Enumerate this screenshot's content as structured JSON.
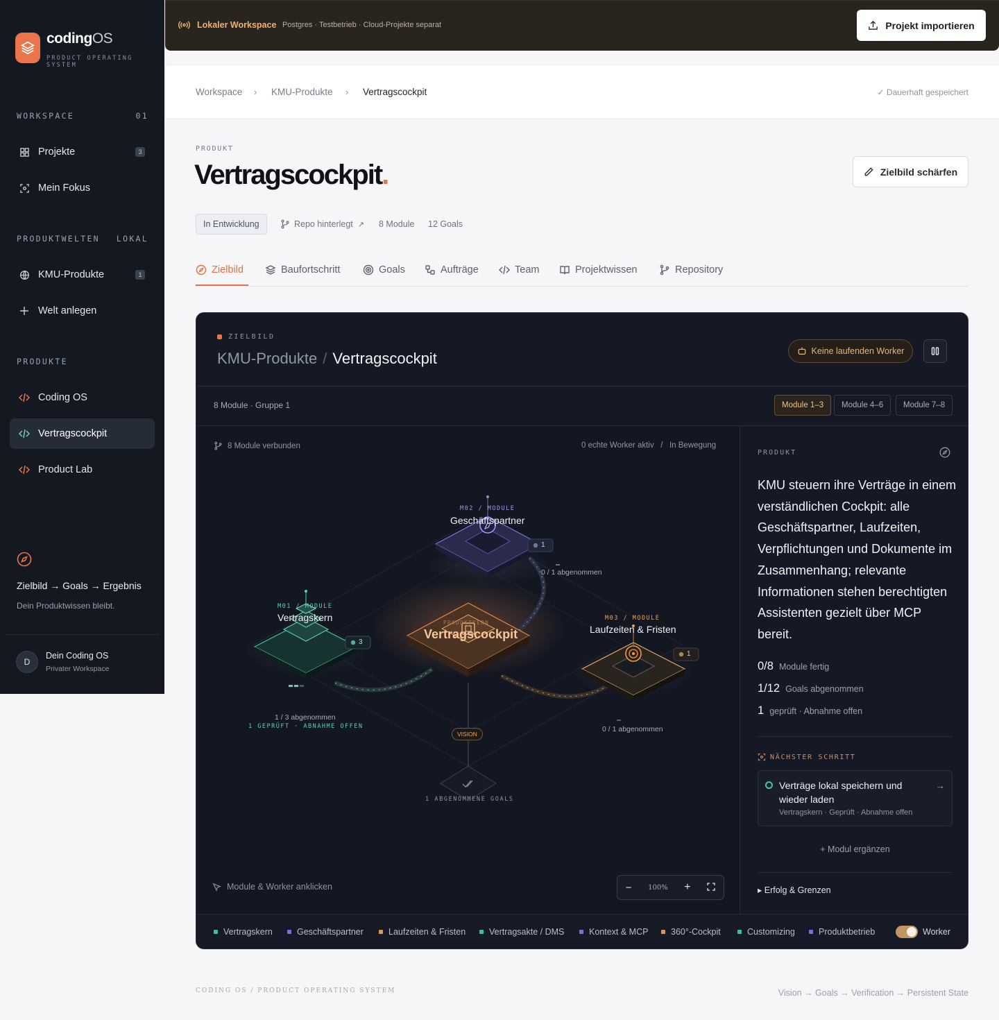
{
  "brand": {
    "name": "coding",
    "name_suffix": "OS",
    "subtitle": "PRODUCT OPERATING SYSTEM"
  },
  "sidebar": {
    "workspace_heading": "WORKSPACE",
    "workspace_number": "01",
    "workspace_items": [
      {
        "label": "Projekte",
        "count": "3",
        "icon": "grid-icon"
      },
      {
        "label": "Mein Fokus",
        "icon": "focus-icon"
      }
    ],
    "worlds_heading": "PRODUKTWELTEN",
    "worlds_tag": "LOKAL",
    "world_items": [
      {
        "label": "KMU-Produkte",
        "count": "1",
        "icon": "globe-icon"
      },
      {
        "label": "Welt anlegen",
        "icon": "plus-icon"
      }
    ],
    "products_heading": "PRODUKTE",
    "product_items": [
      {
        "label": "Coding OS",
        "icon": "code-icon"
      },
      {
        "label": "Vertragscockpit",
        "icon": "code-icon",
        "active": true
      },
      {
        "label": "Product Lab",
        "icon": "code-icon"
      }
    ],
    "flow": "Zielbild → Goals → Ergebnis",
    "flow_sub": "Dein Produktwissen bleibt.",
    "user": {
      "initial": "D",
      "name": "Dein Coding OS",
      "sub": "Privater Workspace"
    }
  },
  "banner": {
    "title": "Lokaler Workspace",
    "subtitle": "Postgres · Testbetrieb · Cloud-Projekte separat",
    "import_label": "Projekt importieren"
  },
  "breadcrumb": {
    "items": [
      "Workspace",
      "KMU-Produkte",
      "Vertragscockpit"
    ],
    "saved": "Dauerhaft gespeichert"
  },
  "header": {
    "eyebrow": "PRODUKT",
    "title": "Vertragscockpit",
    "title_dot": ".",
    "sharpen_label": "Zielbild schärfen",
    "status": "In Entwicklung",
    "repo": "Repo hinterlegt",
    "modules": "8 Module",
    "goals": "12 Goals"
  },
  "tabs": [
    "Zielbild",
    "Baufortschritt",
    "Goals",
    "Aufträge",
    "Team",
    "Projektwissen",
    "Repository"
  ],
  "panel": {
    "eyebrow": "ZIELBILD",
    "world": "KMU-Produkte",
    "slash": "/",
    "product": "Vertragscockpit",
    "worker_pill": "Keine laufenden Worker",
    "module_count": "8 Module · Gruppe 1",
    "segments": [
      "Module 1–3",
      "Module 4–6",
      "Module 7–8"
    ],
    "canvas_left": "8 Module verbunden",
    "canvas_right": "0 echte Worker aktiv   /   In Bewegung",
    "hint": "Module & Worker anklicken",
    "zoom": "100%"
  },
  "diagram": {
    "m02": {
      "code": "M02 / MODULE",
      "name": "Geschäftspartner",
      "badge": "1",
      "progress": "0 / 1 abgenommen"
    },
    "m01": {
      "code": "M01 / MODULE",
      "name": "Vertragskern",
      "badge": "3",
      "progress": "1 / 3 abgenommen",
      "status": "1 GEPRÜFT · ABNAHME OFFEN"
    },
    "m03": {
      "code": "M03 / MODULE",
      "name": "Laufzeiten & Fristen",
      "badge": "1",
      "progress": "0 / 1 abgenommen"
    },
    "core": {
      "code": "PRODUKTKERN",
      "name": "Vertragscockpit"
    },
    "vision": "VISION",
    "goals": "1 ABGENOMMENE GOALS"
  },
  "side": {
    "eyebrow": "PRODUKT",
    "description": "KMU steuern ihre Verträge in einem verständlichen Cockpit: alle Geschäftspartner, Laufzeiten, Verpflichtungen und Dokumente im Zusammenhang; relevante Informationen stehen berechtigten Assistenten gezielt über MCP bereit.",
    "stats": [
      {
        "value": "0/8",
        "label": "Module fertig"
      },
      {
        "value": "1/12",
        "label": "Goals abgenommen"
      },
      {
        "value": "1",
        "label": "geprüft · Abnahme offen"
      }
    ],
    "next_heading": "NÄCHSTER SCHRITT",
    "next_title": "Verträge lokal speichern und wieder laden",
    "next_sub": "Vertragskern · Geprüft · Abnahme offen",
    "add_module": "+ Modul ergänzen",
    "expander": "▸ Erfolg & Grenzen"
  },
  "legend": {
    "items": [
      {
        "label": "Vertragskern",
        "color": "#3fbf9b"
      },
      {
        "label": "Geschäftspartner",
        "color": "#7c6fe0"
      },
      {
        "label": "Laufzeiten & Fristen",
        "color": "#e2954f"
      },
      {
        "label": "Vertragsakte / DMS",
        "color": "#3fbf9b"
      },
      {
        "label": "Kontext & MCP",
        "color": "#7c6fe0"
      },
      {
        "label": "360°-Cockpit",
        "color": "#e2954f"
      },
      {
        "label": "Customizing",
        "color": "#3fbf9b"
      },
      {
        "label": "Produktbetrieb",
        "color": "#7c6fe0"
      }
    ],
    "toggle_label": "Worker"
  },
  "footer": {
    "left": "CODING OS / PRODUCT OPERATING SYSTEM",
    "right": "Vision → Goals → Verification → Persistent State"
  },
  "colors": {
    "accent": "#e9754a",
    "sidebar_bg": "#131821",
    "panel_bg": "#141925",
    "teal": "#3fbf9b",
    "violet": "#7c6fe0",
    "amber": "#e2954f"
  }
}
